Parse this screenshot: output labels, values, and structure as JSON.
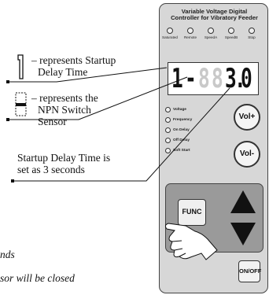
{
  "legend": {
    "item1": {
      "glyph": "|",
      "line1": "– represents Startup",
      "line2": "Delay Time"
    },
    "item2": {
      "glyph": "–",
      "line1": "– represents the",
      "line2": "NPN Switch",
      "line3": "Sensor"
    },
    "item3": {
      "line1": "Startup Delay Time is",
      "line2": "set as 3 seconds"
    }
  },
  "cut_text": {
    "line1": "nds",
    "line2": "sor will be closed"
  },
  "controller": {
    "title_line1": "Variable Voltage Digital",
    "title_line2": "Controller for Vibratory Feeder",
    "top_leds": [
      "Saturated",
      "Remote",
      "SpeedA",
      "SpeedB",
      "Stop"
    ],
    "display": {
      "d1": "1",
      "d2": "-",
      "d3": "8",
      "d4": "8",
      "d5": "3",
      "d6": ".",
      "d7": "0"
    },
    "status_leds": [
      "Voltage",
      "Frequency",
      "On Delay",
      "Off Delay",
      "Soft Start"
    ],
    "buttons": {
      "vol_up": "Vol+",
      "vol_down": "Vol-",
      "func": "FUNC",
      "onoff": "ON/OFF"
    }
  }
}
